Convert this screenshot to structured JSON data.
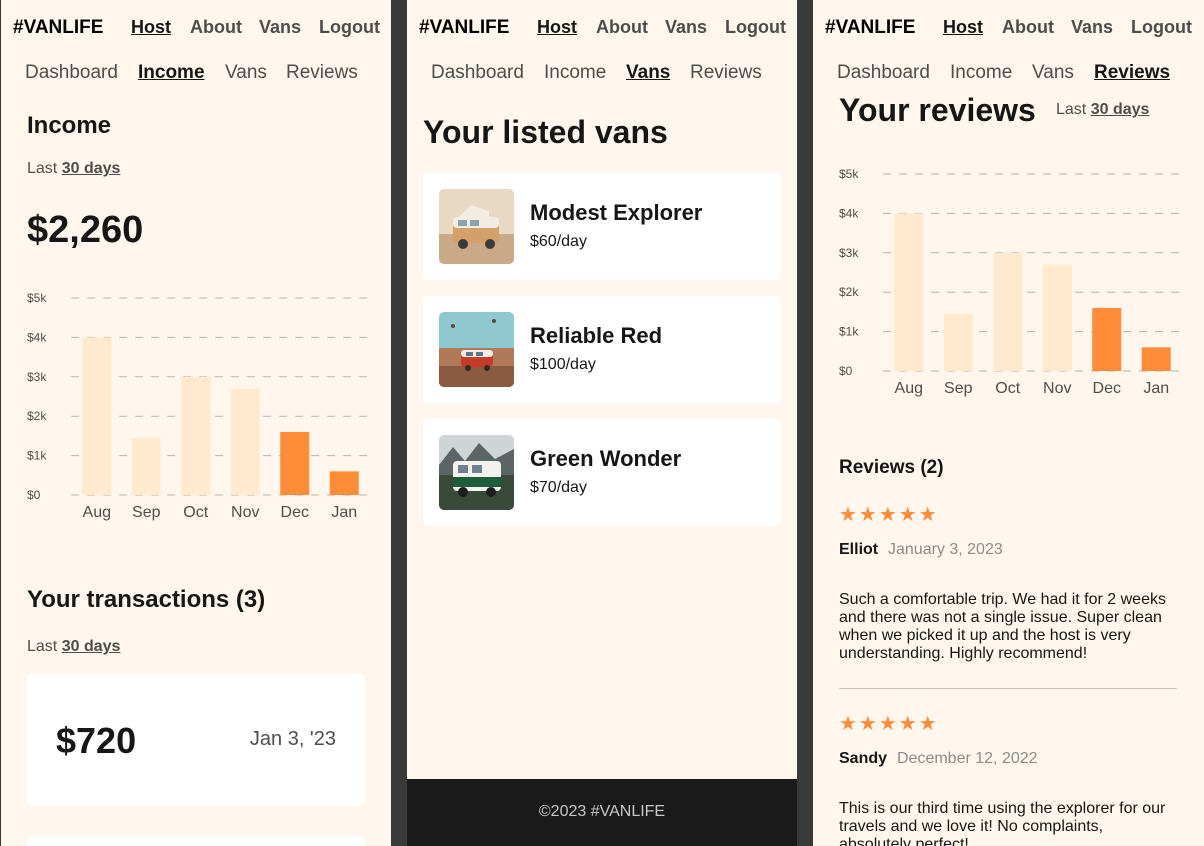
{
  "brand": "#VANLIFE",
  "topnav": [
    "Host",
    "About",
    "Vans",
    "Logout"
  ],
  "subnav": [
    "Dashboard",
    "Income",
    "Vans",
    "Reviews"
  ],
  "income": {
    "title": "Income",
    "last_prefix": "Last",
    "last_value": "30 days",
    "total": "$2,260",
    "transactions_title": "Your transactions (3)",
    "transactions": [
      {
        "amount": "$720",
        "date": "Jan 3, '23"
      }
    ]
  },
  "vans": {
    "title": "Your listed vans",
    "items": [
      {
        "name": "Modest Explorer",
        "price": "$60/day"
      },
      {
        "name": "Reliable Red",
        "price": "$100/day"
      },
      {
        "name": "Green Wonder",
        "price": "$70/day"
      }
    ],
    "footer": "©2023 #VANLIFE"
  },
  "reviews": {
    "title": "Your reviews",
    "last_prefix": "Last",
    "last_value": "30 days",
    "heading": "Reviews (2)",
    "items": [
      {
        "stars": 5,
        "name": "Elliot",
        "date": "January 3, 2023",
        "text": "Such a comfortable trip. We had it for 2 weeks and there was not a single issue. Super clean when we picked it up and the host is very understanding. Highly recommend!"
      },
      {
        "stars": 5,
        "name": "Sandy",
        "date": "December 12, 2022",
        "text": "This is our third time using the explorer for our travels and we love it! No complaints, absolutely perfect!"
      }
    ]
  },
  "chart_data": {
    "type": "bar",
    "categories": [
      "Aug",
      "Sep",
      "Oct",
      "Nov",
      "Dec",
      "Jan"
    ],
    "values": [
      4000,
      1450,
      3000,
      2700,
      1600,
      600
    ],
    "highlight": [
      "Dec",
      "Jan"
    ],
    "yticks": [
      "$0",
      "$1k",
      "$2k",
      "$3k",
      "$4k",
      "$5k"
    ],
    "ylim": [
      0,
      5000
    ],
    "grid": true,
    "colors": {
      "normal": "#ffead0",
      "highlight": "#ff8c38"
    }
  },
  "colors": {
    "background": "#fff7ed",
    "accent": "#ff8c38",
    "footer": "#252525"
  }
}
